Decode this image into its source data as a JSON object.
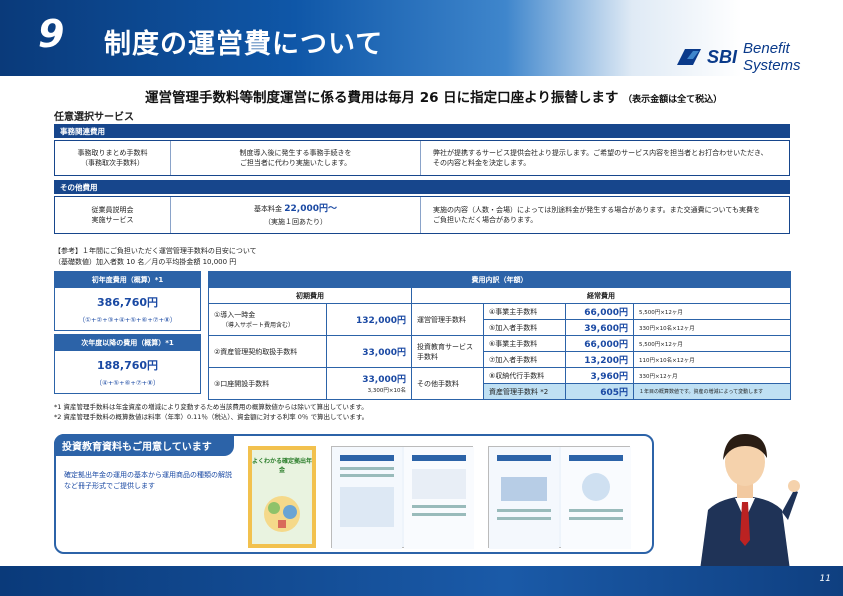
{
  "header": {
    "number": "9",
    "title": "制度の運営費について",
    "logo_sbi": "SBI",
    "logo_text": "Benefit Systems"
  },
  "headline": {
    "main": "運営管理手数料等制度運営に係る費用は毎月 26 日に指定口座より振替します",
    "note": "（表示金額は全て税込）"
  },
  "optional_services": {
    "label": "任意選択サービス",
    "office": {
      "bar": "事務関連費用",
      "name_1": "事務取りまとめ手数料",
      "name_2": "（事務取次手数料）",
      "desc_1": "制度導入後に発生する事務手続きを",
      "desc_2": "ご担当者に代わり実施いたします。",
      "note_1": "弊社が提携するサービス提供会社より提示します。ご希望のサービス内容を担当者とお打合わせいただき、",
      "note_2": "その内容と料金を決定します。"
    },
    "other": {
      "bar": "その他費用",
      "name_1": "従業員説明会",
      "name_2": "実施サービス",
      "desc_prefix": "基本料金",
      "desc_price": "22,000円〜",
      "desc_sub": "（実施１回あたり）",
      "note_1": "実施の内容（人数・会場）によっては別途料金が発生する場合があります。また交通費についても実費を",
      "note_2": "ご負担いただく場合があります。"
    }
  },
  "reference": {
    "line1": "【参考】１年間にご負担いただく運営管理手数料の目安について",
    "line2": "（基礎数値）加入者数 10 名／月の平均掛金額 10,000 円"
  },
  "summary": {
    "first_year_head": "初年度費用（概算）*1",
    "first_year_value": "386,760円",
    "first_year_formula": "（①+②+③+④+⑤+⑥+⑦+⑧）",
    "next_year_head": "次年度以降の費用（概算）*1",
    "next_year_value": "188,760円",
    "next_year_formula": "（④+⑤+⑥+⑦+⑧）"
  },
  "breakdown": {
    "header": "費用内訳（年額）",
    "initial_head": "初期費用",
    "recurring_head": "経常費用",
    "initial": [
      {
        "name": "①導入一時金",
        "sub": "（導入サポート費用含む）",
        "value": "132,000円",
        "sub_value": ""
      },
      {
        "name": "②資産管理契約取扱手数料",
        "sub": "",
        "value": "33,000円",
        "sub_value": ""
      },
      {
        "name": "③口座開設手数料",
        "sub": "",
        "value": "33,000円",
        "sub_value": "3,300円×10名"
      }
    ],
    "groups": [
      {
        "name": "運営管理手数料",
        "items": [
          {
            "label": "④事業主手数料",
            "value": "66,000円",
            "calc": "5,500円×12ヶ月"
          },
          {
            "label": "⑤加入者手数料",
            "value": "39,600円",
            "calc": "330円×10名×12ヶ月"
          }
        ]
      },
      {
        "name": "投資教育サービス手数料",
        "items": [
          {
            "label": "⑥事業主手数料",
            "value": "66,000円",
            "calc": "5,500円×12ヶ月"
          },
          {
            "label": "⑦加入者手数料",
            "value": "13,200円",
            "calc": "110円×10名×12ヶ月"
          }
        ]
      },
      {
        "name": "その他手数料",
        "items": [
          {
            "label": "⑧収納代行手数料",
            "value": "3,960円",
            "calc": "330円×12ヶ月"
          },
          {
            "label": "資産管理手数料 *2",
            "value": "605円",
            "calc": "１年目の概算数値です。資産の増減によって変動します"
          }
        ]
      }
    ]
  },
  "notes": {
    "n1": "*1 資産管理手数料は年金資産の増減により変動するため当該費用の概算数値からは除いて算出しています。",
    "n2": "*2 資産管理手数料の概算数値は料率（年率）0.11％（税込）、資金額に対する利率 0％ で算出しています。"
  },
  "promo": {
    "tag": "投資教育資料もご用意しています",
    "text": "確定拠出年金の運用の基本から運用商品の種類の解説など冊子形式でご提供します",
    "book_title": "よくわかる確定拠出年金"
  },
  "footer": {
    "page": "11"
  },
  "colors": {
    "brand": "#17468c",
    "accent": "#2c63a8",
    "value": "#1a49a3",
    "highlight": "#bfe0f3"
  }
}
